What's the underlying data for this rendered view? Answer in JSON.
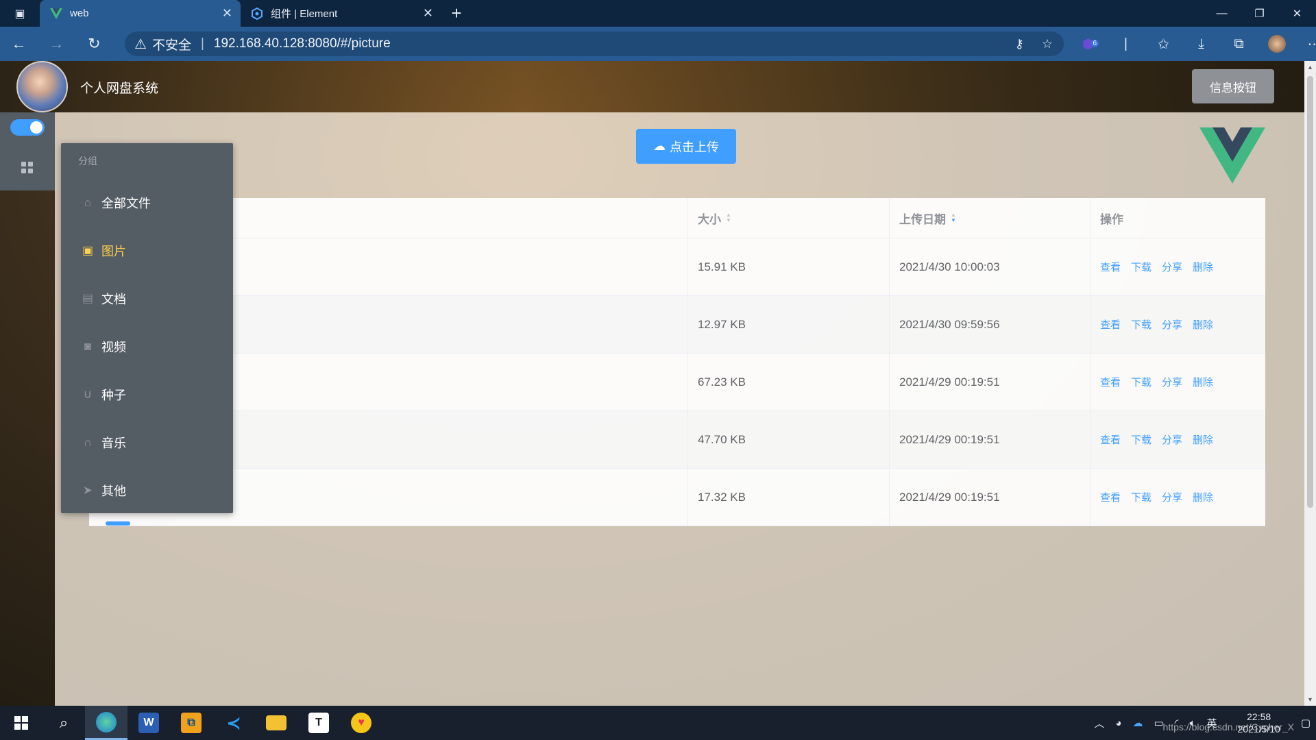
{
  "browser": {
    "tabs": [
      {
        "title": "web",
        "active": true,
        "icon": "vue-icon"
      },
      {
        "title": "组件 | Element",
        "active": false,
        "icon": "element-icon"
      }
    ],
    "security_label": "不安全",
    "url": "192.168.40.128:8080/#/picture",
    "extension_badge": "6"
  },
  "header": {
    "title": "个人网盘系统",
    "info_button": "信息按钮"
  },
  "actions": {
    "upload_label": "点击上传"
  },
  "menu": {
    "group_label": "分组",
    "items": [
      {
        "label": "全部文件",
        "icon": "home-icon"
      },
      {
        "label": "图片",
        "icon": "picture-icon",
        "active": true
      },
      {
        "label": "文档",
        "icon": "document-icon"
      },
      {
        "label": "视频",
        "icon": "video-camera-icon"
      },
      {
        "label": "种子",
        "icon": "magnet-icon"
      },
      {
        "label": "音乐",
        "icon": "headset-icon"
      },
      {
        "label": "其他",
        "icon": "send-icon"
      }
    ]
  },
  "table": {
    "columns": {
      "size": "大小",
      "date": "上传日期",
      "ops": "操作"
    },
    "rows": [
      {
        "size": "15.91 KB",
        "date": "2021/4/30 10:00:03"
      },
      {
        "size": "12.97 KB",
        "date": "2021/4/30 09:59:56"
      },
      {
        "size": "67.23 KB",
        "date": "2021/4/29 00:19:51"
      },
      {
        "size": "47.70 KB",
        "date": "2021/4/29 00:19:51"
      },
      {
        "size": "17.32 KB",
        "date": "2021/4/29 00:19:51"
      }
    ],
    "ops": {
      "view": "查看",
      "download": "下载",
      "share": "分享",
      "delete": "删除"
    }
  },
  "taskbar": {
    "lang": "英",
    "time": "22:58",
    "date": "2021/5/10",
    "watermark": "https://blog.csdn.net/Cypher_X"
  },
  "colors": {
    "accent": "#409eff",
    "menu_bg": "#545c64",
    "menu_active": "#ffd04b",
    "browser_bar": "#275b91"
  }
}
